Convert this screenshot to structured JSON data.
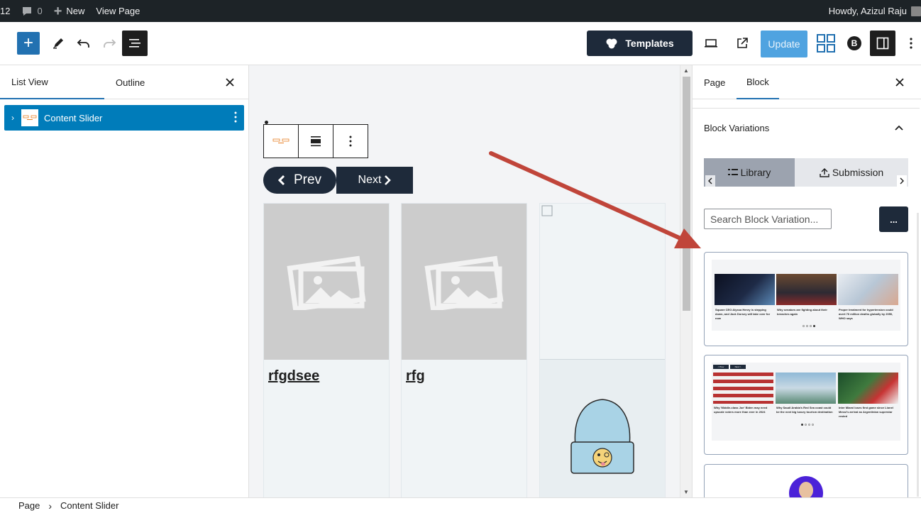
{
  "adminbar": {
    "counter": "12",
    "comments": "0",
    "new_label": "New",
    "view_page": "View Page",
    "howdy": "Howdy, Azizul Raju"
  },
  "header": {
    "templates_label": "Templates",
    "update_label": "Update",
    "brand_letter": "B"
  },
  "listview": {
    "tabs": [
      "List View",
      "Outline"
    ],
    "active_tab": "List View",
    "items": [
      {
        "label": "Content Slider"
      }
    ]
  },
  "canvas": {
    "prev_label": "Prev",
    "next_label": "Next",
    "cards": [
      {
        "title": "rfgdsee"
      },
      {
        "title": "rfg"
      },
      {
        "title": ""
      }
    ]
  },
  "sidebar": {
    "tabs": [
      "Page",
      "Block"
    ],
    "active_tab": "Block",
    "section_title": "Block Variations",
    "variation_tabs": [
      "Library",
      "Submission"
    ],
    "search_placeholder": "Search Block Variation...",
    "more_label": "...",
    "variations": [
      {
        "captions": [
          "Square CEO Alyssa Henry is stepping down, and Jack Dorsey will take over for now",
          "Why senators are fighting about their breaches again",
          "Proper treatment for hypertension could avert 76 million deaths globally by 2050, WHO says"
        ]
      },
      {
        "captions": [
          "Why 'Middle-class Joe' Biden may need upscale voters more than ever in 2024",
          "Why Saudi Arabia's Red Sea coast could be the next big luxury tourism destination",
          "Inter Miami loses first game since Lionel Messi's arrival as Argentinian superstar rested"
        ],
        "mini_buttons": [
          "< Prev",
          "Next >"
        ]
      },
      {
        "captions": []
      }
    ]
  },
  "footer": {
    "breadcrumbs": [
      "Page",
      "Content Slider"
    ]
  },
  "colors": {
    "accent": "#2271b1",
    "dark_button": "#1e2a3a",
    "annotation_arrow": "#c0453a"
  }
}
